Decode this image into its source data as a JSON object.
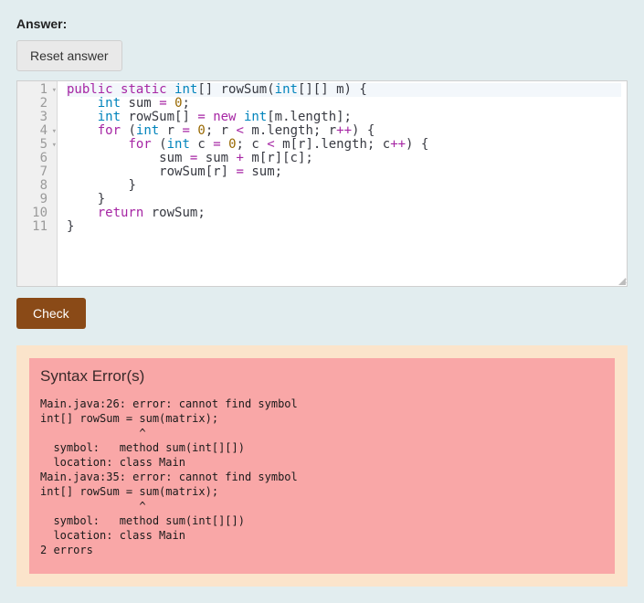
{
  "labels": {
    "answer": "Answer:",
    "reset": "Reset answer",
    "check": "Check"
  },
  "editor": {
    "line_numbers": [
      "1",
      "2",
      "3",
      "4",
      "5",
      "6",
      "7",
      "8",
      "9",
      "10",
      "11"
    ],
    "fold_lines": [
      1,
      4,
      5
    ],
    "highlight_line": 1,
    "code_tokens": [
      [
        [
          "kw",
          "public"
        ],
        [
          "sp",
          " "
        ],
        [
          "kw",
          "static"
        ],
        [
          "sp",
          " "
        ],
        [
          "ty",
          "int"
        ],
        [
          "pn",
          "[] "
        ],
        [
          "id",
          "rowSum"
        ],
        [
          "pn",
          "("
        ],
        [
          "ty",
          "int"
        ],
        [
          "pn",
          "[][] "
        ],
        [
          "id",
          "m"
        ],
        [
          "pn",
          ") {"
        ]
      ],
      [
        [
          "sp",
          "    "
        ],
        [
          "ty",
          "int"
        ],
        [
          "sp",
          " "
        ],
        [
          "id",
          "sum"
        ],
        [
          "sp",
          " "
        ],
        [
          "op",
          "="
        ],
        [
          "sp",
          " "
        ],
        [
          "num",
          "0"
        ],
        [
          "pn",
          ";"
        ]
      ],
      [
        [
          "sp",
          "    "
        ],
        [
          "ty",
          "int"
        ],
        [
          "sp",
          " "
        ],
        [
          "id",
          "rowSum"
        ],
        [
          "pn",
          "[] "
        ],
        [
          "op",
          "="
        ],
        [
          "sp",
          " "
        ],
        [
          "kw",
          "new"
        ],
        [
          "sp",
          " "
        ],
        [
          "ty",
          "int"
        ],
        [
          "pn",
          "["
        ],
        [
          "id",
          "m"
        ],
        [
          "pn",
          "."
        ],
        [
          "id",
          "length"
        ],
        [
          "pn",
          "];"
        ]
      ],
      [
        [
          "sp",
          "    "
        ],
        [
          "kw",
          "for"
        ],
        [
          "sp",
          " "
        ],
        [
          "pn",
          "("
        ],
        [
          "ty",
          "int"
        ],
        [
          "sp",
          " "
        ],
        [
          "id",
          "r"
        ],
        [
          "sp",
          " "
        ],
        [
          "op",
          "="
        ],
        [
          "sp",
          " "
        ],
        [
          "num",
          "0"
        ],
        [
          "pn",
          "; "
        ],
        [
          "id",
          "r"
        ],
        [
          "sp",
          " "
        ],
        [
          "op",
          "<"
        ],
        [
          "sp",
          " "
        ],
        [
          "id",
          "m"
        ],
        [
          "pn",
          "."
        ],
        [
          "id",
          "length"
        ],
        [
          "pn",
          "; "
        ],
        [
          "id",
          "r"
        ],
        [
          "op",
          "++"
        ],
        [
          "pn",
          ") {"
        ]
      ],
      [
        [
          "sp",
          "        "
        ],
        [
          "kw",
          "for"
        ],
        [
          "sp",
          " "
        ],
        [
          "pn",
          "("
        ],
        [
          "ty",
          "int"
        ],
        [
          "sp",
          " "
        ],
        [
          "id",
          "c"
        ],
        [
          "sp",
          " "
        ],
        [
          "op",
          "="
        ],
        [
          "sp",
          " "
        ],
        [
          "num",
          "0"
        ],
        [
          "pn",
          "; "
        ],
        [
          "id",
          "c"
        ],
        [
          "sp",
          " "
        ],
        [
          "op",
          "<"
        ],
        [
          "sp",
          " "
        ],
        [
          "id",
          "m"
        ],
        [
          "pn",
          "["
        ],
        [
          "id",
          "r"
        ],
        [
          "pn",
          "]."
        ],
        [
          "id",
          "length"
        ],
        [
          "pn",
          "; "
        ],
        [
          "id",
          "c"
        ],
        [
          "op",
          "++"
        ],
        [
          "pn",
          ") {"
        ]
      ],
      [
        [
          "sp",
          "            "
        ],
        [
          "id",
          "sum"
        ],
        [
          "sp",
          " "
        ],
        [
          "op",
          "="
        ],
        [
          "sp",
          " "
        ],
        [
          "id",
          "sum"
        ],
        [
          "sp",
          " "
        ],
        [
          "op",
          "+"
        ],
        [
          "sp",
          " "
        ],
        [
          "id",
          "m"
        ],
        [
          "pn",
          "["
        ],
        [
          "id",
          "r"
        ],
        [
          "pn",
          "]["
        ],
        [
          "id",
          "c"
        ],
        [
          "pn",
          "];"
        ]
      ],
      [
        [
          "sp",
          "            "
        ],
        [
          "id",
          "rowSum"
        ],
        [
          "pn",
          "["
        ],
        [
          "id",
          "r"
        ],
        [
          "pn",
          "] "
        ],
        [
          "op",
          "="
        ],
        [
          "sp",
          " "
        ],
        [
          "id",
          "sum"
        ],
        [
          "pn",
          ";"
        ]
      ],
      [
        [
          "sp",
          "        "
        ],
        [
          "pn",
          "}"
        ]
      ],
      [
        [
          "sp",
          "    "
        ],
        [
          "pn",
          "}"
        ]
      ],
      [
        [
          "sp",
          "    "
        ],
        [
          "kw",
          "return"
        ],
        [
          "sp",
          " "
        ],
        [
          "id",
          "rowSum"
        ],
        [
          "pn",
          ";"
        ]
      ],
      [
        [
          "pn",
          "}"
        ]
      ]
    ]
  },
  "error": {
    "title": "Syntax Error(s)",
    "body": "Main.java:26: error: cannot find symbol\nint[] rowSum = sum(matrix);\n               ^\n  symbol:   method sum(int[][])\n  location: class Main\nMain.java:35: error: cannot find symbol\nint[] rowSum = sum(matrix);\n               ^\n  symbol:   method sum(int[][])\n  location: class Main\n2 errors"
  }
}
